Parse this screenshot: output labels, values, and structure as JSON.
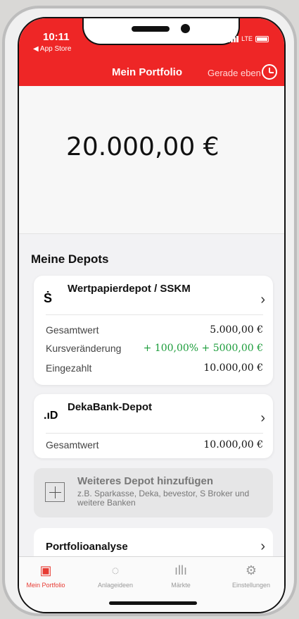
{
  "status": {
    "time": "10:11",
    "back_app": "◀ App Store",
    "network": "LTE"
  },
  "nav": {
    "title": "Mein Portfolio",
    "subtitle": "Gerade eben"
  },
  "portfolio": {
    "total": "20.000,00 €"
  },
  "depots": {
    "section_title": "Meine Depots",
    "items": [
      {
        "title": "Wertpapierdepot / SSKM",
        "logo": "Ṡ",
        "rows": [
          {
            "label": "Gesamtwert",
            "value": "5.000,00 €"
          },
          {
            "label": "Kursveränderung",
            "value": "+ 100,00%  + 5000,00 €"
          },
          {
            "label": "Eingezahlt",
            "value": "10.000,00 €"
          }
        ]
      },
      {
        "title": "DekaBank-Depot",
        "logo": ".ıD",
        "rows": [
          {
            "label": "Gesamtwert",
            "value": "10.000,00 €"
          }
        ]
      }
    ],
    "add": {
      "title": "Weiteres Depot hinzufügen",
      "subtitle": "z.B. Sparkasse, Deka, bevestor, S Broker und weitere Banken"
    }
  },
  "analysis": {
    "title": "Portfolioanalyse"
  },
  "tabs": [
    {
      "label": "Mein Portfolio",
      "icon": "wallet-icon",
      "glyph": "▣"
    },
    {
      "label": "Anlageideen",
      "icon": "lightbulb-icon",
      "glyph": "◌"
    },
    {
      "label": "Märkte",
      "icon": "chart-bars-icon",
      "glyph": "ıllı"
    },
    {
      "label": "Einstellungen",
      "icon": "gear-icon",
      "glyph": "⚙"
    }
  ],
  "colors": {
    "brand": "#ee2626",
    "positive": "#1b9c3a",
    "tab_active": "#e73b33"
  }
}
